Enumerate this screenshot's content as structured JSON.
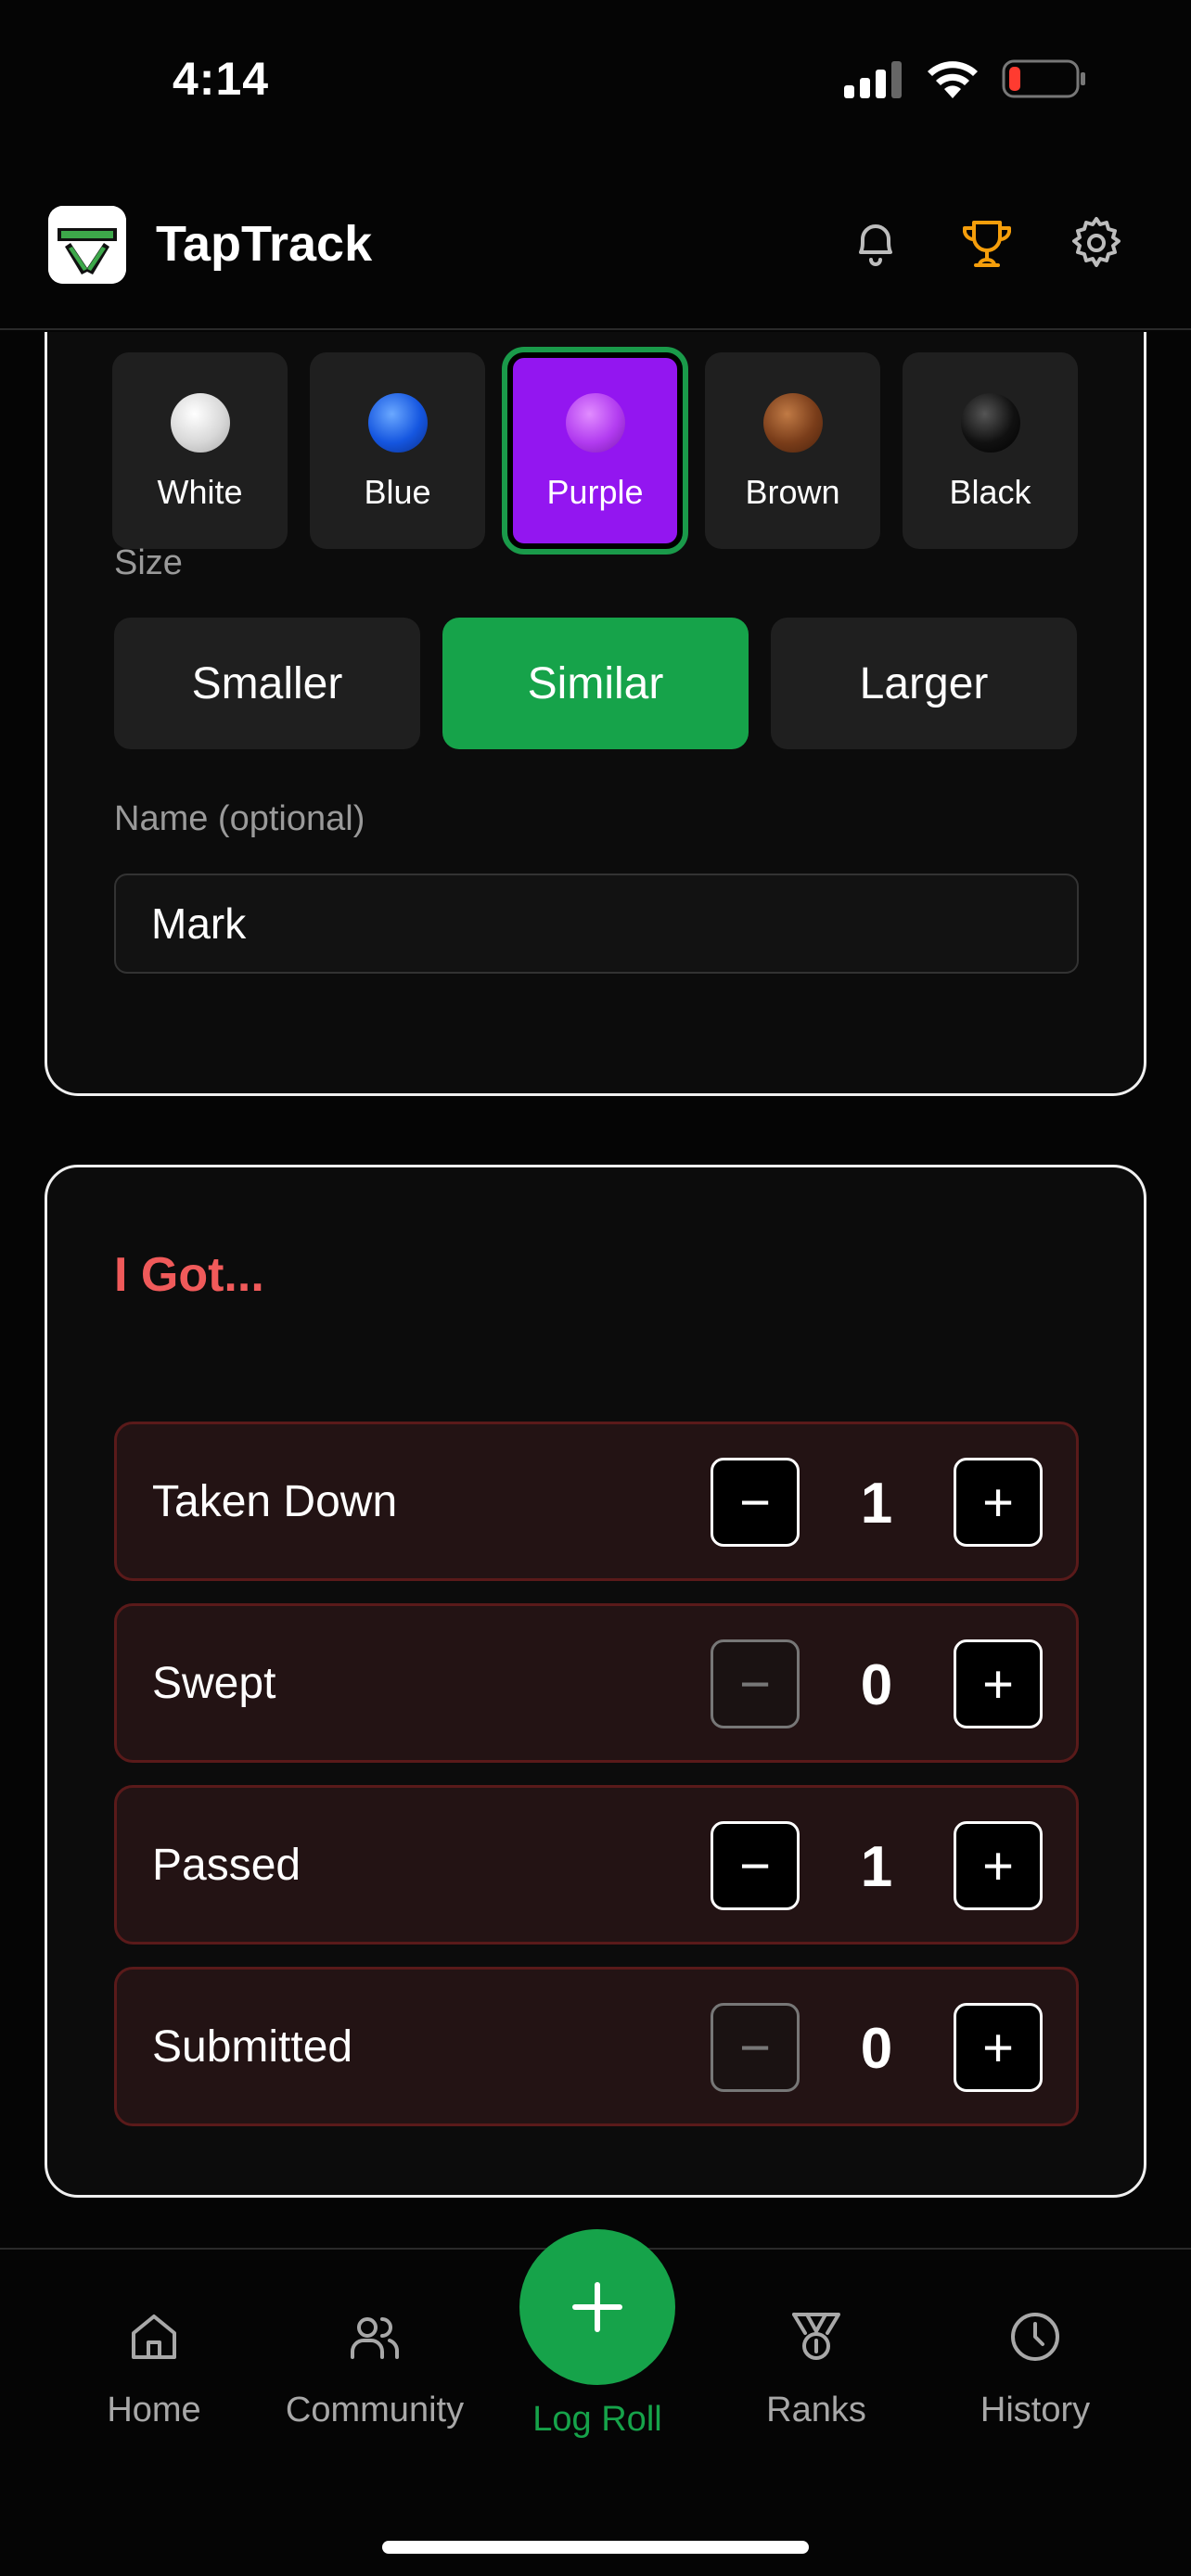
{
  "status_bar": {
    "time": "4:14"
  },
  "header": {
    "app_name": "TapTrack",
    "icons": [
      "bell-icon",
      "trophy-icon",
      "gear-icon"
    ]
  },
  "belt_selector": {
    "options": [
      {
        "label": "White",
        "color": "#e8e8e8"
      },
      {
        "label": "Blue",
        "color": "#1556e0"
      },
      {
        "label": "Purple",
        "color": "#b23cf0"
      },
      {
        "label": "Brown",
        "color": "#7a3d1a"
      },
      {
        "label": "Black",
        "color": "#0a0a0a"
      }
    ],
    "selected": "Purple"
  },
  "size": {
    "label": "Size",
    "options": [
      "Smaller",
      "Similar",
      "Larger"
    ],
    "selected": "Similar"
  },
  "name": {
    "label": "Name (optional)",
    "value": "Mark"
  },
  "i_got": {
    "title": "I Got...",
    "counters": [
      {
        "label": "Taken Down",
        "value": "1"
      },
      {
        "label": "Swept",
        "value": "0"
      },
      {
        "label": "Passed",
        "value": "1"
      },
      {
        "label": "Submitted",
        "value": "0"
      }
    ]
  },
  "bottom_nav": {
    "items": [
      {
        "label": "Home",
        "icon": "home-icon"
      },
      {
        "label": "Community",
        "icon": "users-icon"
      },
      {
        "label": "Log Roll",
        "icon": "plus-icon"
      },
      {
        "label": "Ranks",
        "icon": "medal-icon"
      },
      {
        "label": "History",
        "icon": "clock-icon"
      }
    ]
  },
  "colors": {
    "accent": "#16a34a",
    "danger_title": "#f05a5a",
    "trophy": "#f59e0b",
    "purple": "#9316f0"
  }
}
